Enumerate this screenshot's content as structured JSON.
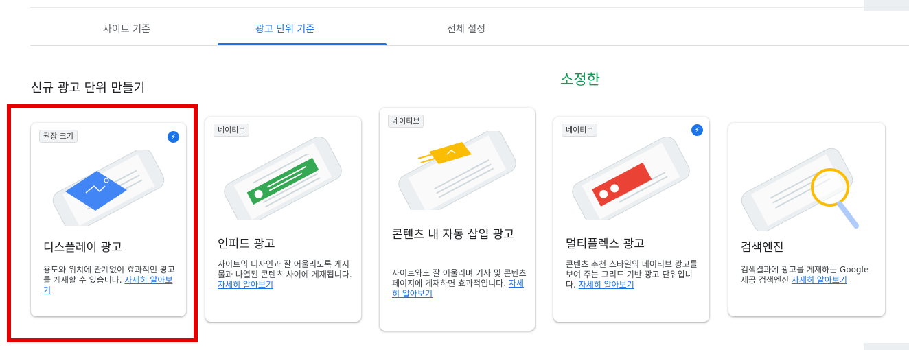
{
  "tabs": [
    {
      "label": "사이트 기준"
    },
    {
      "label": "광고 단위 기준"
    },
    {
      "label": "전체 설정"
    }
  ],
  "section_title": "신규 광고 단위 만들기",
  "annotation": "소정한",
  "cards": [
    {
      "badge": "권장 크기",
      "title": "디스플레이 광고",
      "description": "용도와 위치에 관계없이 효과적인 광고를 게재할 수 있습니다. ",
      "link": "자세히 알아보기",
      "bolt": "lightning-icon"
    },
    {
      "badge": "네이티브",
      "title": "인피드 광고",
      "description": "사이트의 디자인과 잘 어울리도록 게시물과 나열된 콘텐츠 사이에 게재됩니다. ",
      "link": "자세히 알아보기"
    },
    {
      "badge": "네이티브",
      "title": "콘텐츠 내 자동 삽입 광고",
      "description": "사이트와도 잘 어울리며 기사 및 콘텐츠 페이지에 게재하면 효과적입니다. ",
      "link": "자세히 알아보기"
    },
    {
      "badge": "네이티브",
      "title": "멀티플렉스 광고",
      "description": "콘텐츠 추천 스타일의 네이티브 광고를 보여 주는 그리드 기반 광고 단위입니다. ",
      "link": "자세히 알아보기",
      "bolt": "lightning-icon"
    },
    {
      "badge": "",
      "title": "검색엔진",
      "description": "검색결과에 광고를 게재하는 Google 제공 검색엔진 ",
      "link": "자세히 알아보기"
    }
  ],
  "colors": {
    "accent": "#1a73e8",
    "highlight": "#e50000",
    "annotation": "#0f9d58"
  }
}
